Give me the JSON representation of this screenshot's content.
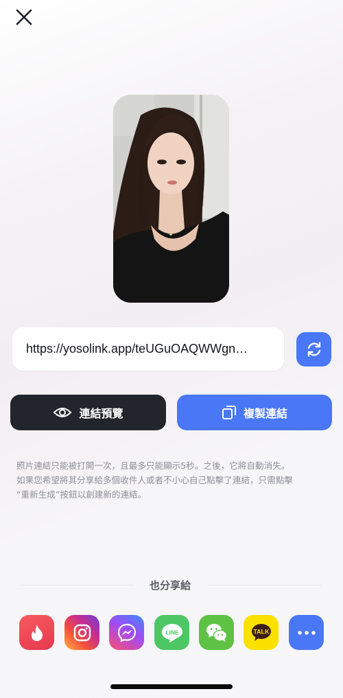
{
  "header": {
    "close_icon": "close-icon"
  },
  "link": {
    "url": "https://yosolink.app/teUGuOAQWWgn…",
    "refresh_icon": "refresh-icon"
  },
  "actions": {
    "preview_label": "連結預覽",
    "preview_icon": "eye-icon",
    "copy_label": "複製連結",
    "copy_icon": "copy-icon"
  },
  "notice": {
    "line1": "照片連結只能被打開一次，且最多只能顯示5秒。之後，它將自動消失。",
    "line2": "如果您希望將其分享給多個收件人或者不小心自己點擊了連結，只需點擊",
    "line3": "“重新生成”按鈕以創建新的連結。"
  },
  "share": {
    "title": "也分享給",
    "apps": [
      {
        "name": "tinder",
        "icon": "tinder-icon",
        "color": "#f0455a"
      },
      {
        "name": "instagram",
        "icon": "instagram-icon",
        "color": "#c13584"
      },
      {
        "name": "messenger",
        "icon": "messenger-icon",
        "color": "#7b5cf5"
      },
      {
        "name": "line",
        "icon": "line-icon",
        "color": "#4cc764"
      },
      {
        "name": "wechat",
        "icon": "wechat-icon",
        "color": "#5ec245"
      },
      {
        "name": "kakaotalk",
        "icon": "kakaotalk-icon",
        "color": "#fae100",
        "label": "TALK"
      },
      {
        "name": "more",
        "icon": "more-icon",
        "color": "#4a77f6"
      }
    ]
  },
  "colors": {
    "accent": "#4a77f6",
    "dark_button": "#22252b",
    "notice_text": "#8e9097"
  }
}
